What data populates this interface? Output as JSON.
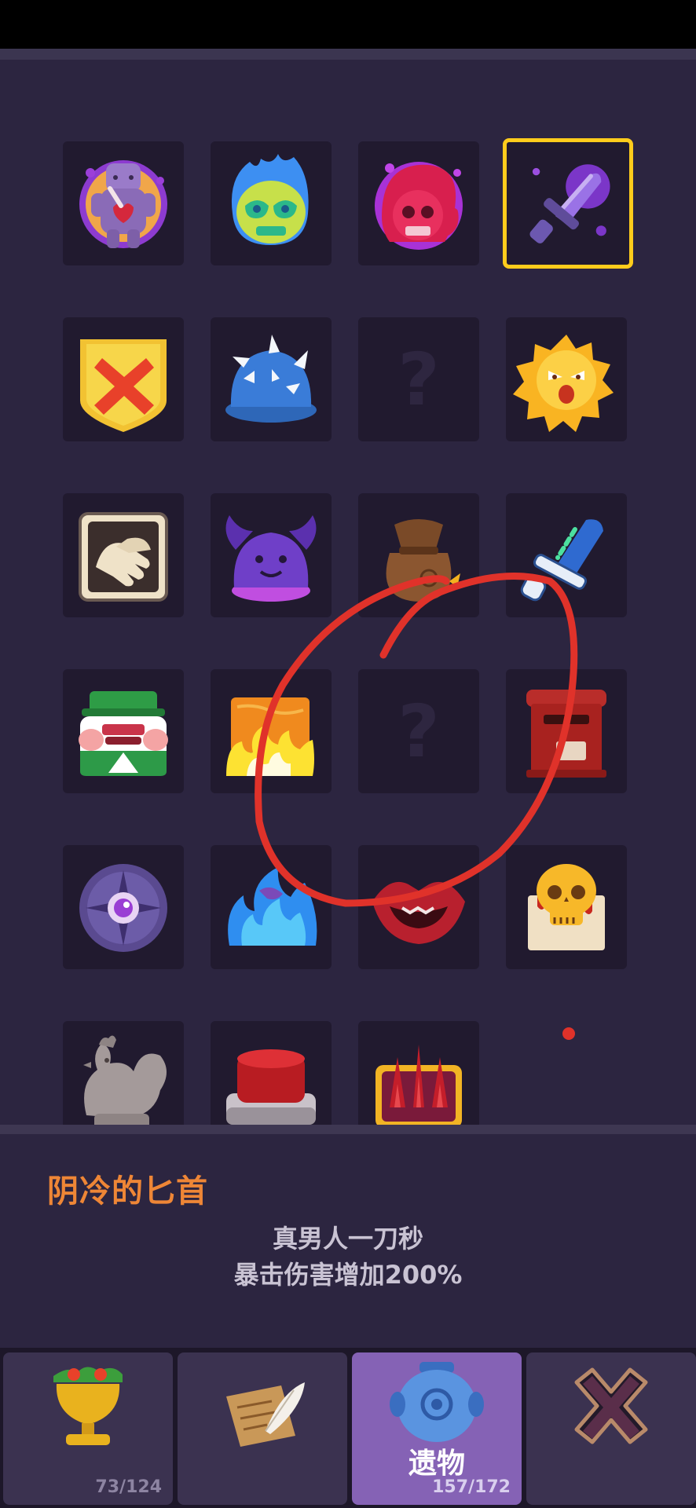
{
  "relic_grid": {
    "slots": [
      {
        "icon": "voodoo-doll-icon",
        "locked": false,
        "selected": false
      },
      {
        "icon": "flaming-skull-icon",
        "locked": false,
        "selected": false
      },
      {
        "icon": "red-skull-cloak-icon",
        "locked": false,
        "selected": false
      },
      {
        "icon": "dark-dagger-icon",
        "locked": false,
        "selected": true
      },
      {
        "icon": "cross-shield-icon",
        "locked": false,
        "selected": false
      },
      {
        "icon": "spiked-helmet-icon",
        "locked": false,
        "selected": false
      },
      {
        "icon": "unknown-relic-icon",
        "locked": true,
        "selected": false,
        "label": "?"
      },
      {
        "icon": "angry-sun-icon",
        "locked": false,
        "selected": false
      },
      {
        "icon": "handshake-card-icon",
        "locked": false,
        "selected": false
      },
      {
        "icon": "bat-helmet-icon",
        "locked": false,
        "selected": false
      },
      {
        "icon": "loot-sack-icon",
        "locked": false,
        "selected": false
      },
      {
        "icon": "bone-sword-icon",
        "locked": false,
        "selected": false
      },
      {
        "icon": "frog-hat-icon",
        "locked": false,
        "selected": false
      },
      {
        "icon": "burning-scroll-icon",
        "locked": false,
        "selected": false
      },
      {
        "icon": "unknown-relic-icon",
        "locked": true,
        "selected": false,
        "label": "?"
      },
      {
        "icon": "mailbox-icon",
        "locked": false,
        "selected": false
      },
      {
        "icon": "eye-compass-icon",
        "locked": false,
        "selected": false
      },
      {
        "icon": "blue-flame-icon",
        "locked": false,
        "selected": false
      },
      {
        "icon": "red-lips-icon",
        "locked": false,
        "selected": false
      },
      {
        "icon": "skull-letter-icon",
        "locked": false,
        "selected": false
      },
      {
        "icon": "stone-rooster-icon",
        "locked": false,
        "selected": false
      },
      {
        "icon": "red-button-icon",
        "locked": false,
        "selected": false
      },
      {
        "icon": "spiked-crown-chest-icon",
        "locked": false,
        "selected": false
      }
    ]
  },
  "detail": {
    "title": "阴冷的匕首",
    "line1": "真男人一刀秒",
    "line2": "暴击伤害增加200%"
  },
  "tabs": [
    {
      "icon": "golden-goblet-icon",
      "label": "",
      "count": "73/124",
      "active": false
    },
    {
      "icon": "scroll-quill-icon",
      "label": "",
      "count": "",
      "active": false
    },
    {
      "icon": "blue-jar-icon",
      "label": "遗物",
      "count": "157/172",
      "active": true
    },
    {
      "icon": "close-x-icon",
      "label": "",
      "count": "",
      "active": false
    }
  ],
  "colors": {
    "panel_bg": "#2c2540",
    "slot_bg": "#211a2f",
    "selected_border": "#ffcc1c",
    "title_orange": "#ee8636",
    "active_tab": "#8562b5",
    "annotation_red": "#e0322a"
  }
}
